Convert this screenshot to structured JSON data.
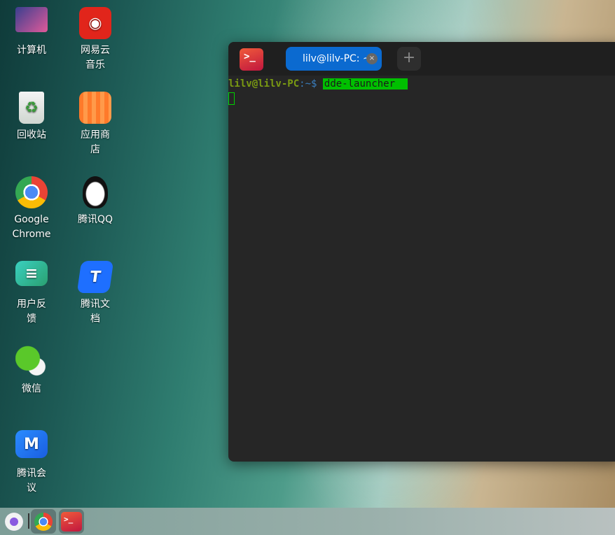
{
  "desktop_icons": [
    {
      "label": "计算机",
      "icon": "computer-icon"
    },
    {
      "label": "网易云音乐",
      "icon": "netease-music-icon"
    },
    {
      "label": "回收站",
      "icon": "trash-icon"
    },
    {
      "label": "应用商店",
      "icon": "app-store-icon"
    },
    {
      "label": "Google Chrome",
      "icon": "chrome-icon"
    },
    {
      "label": "腾讯QQ",
      "icon": "qq-icon"
    },
    {
      "label": "用户反馈",
      "icon": "feedback-icon"
    },
    {
      "label": "腾讯文档",
      "icon": "tencent-docs-icon"
    },
    {
      "label": "微信",
      "icon": "wechat-icon"
    },
    {
      "label": "腾讯会议",
      "icon": "tencent-meeting-icon"
    }
  ],
  "terminal": {
    "app_icon_text": ">_",
    "tab_title": "lilv@lilv-PC: ~",
    "tab_close": "×",
    "new_tab": "+",
    "prompt_user": "lilv@lilv-PC",
    "prompt_sep": ":",
    "prompt_path": "~$",
    "command": "dde-launcher"
  },
  "dock": {
    "items": [
      "launcher",
      "Google Chrome",
      "Terminal"
    ],
    "terminal_text": ">_"
  },
  "colors": {
    "tab_active": "#0b6ad0",
    "prompt_user": "#7a9a12",
    "command_bg": "#00c000"
  }
}
